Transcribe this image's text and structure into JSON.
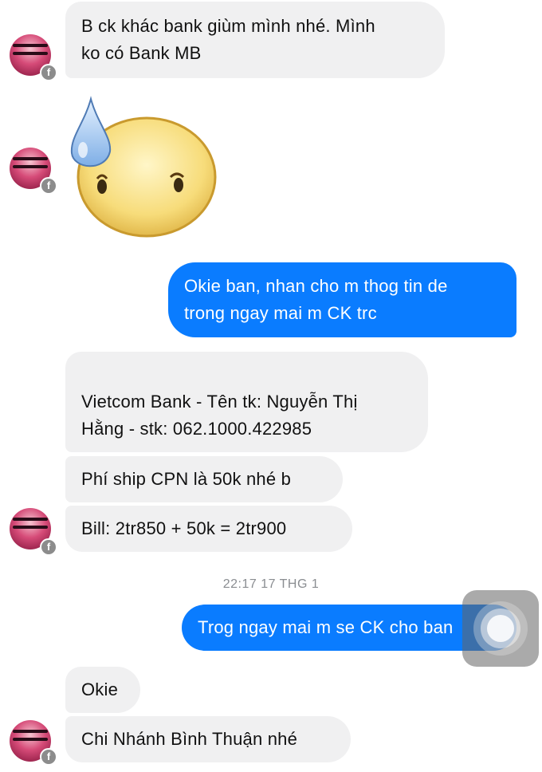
{
  "messages": [
    {
      "side": "in",
      "lines": [
        "B ck khác bank giùm mình nhé. Mình",
        "ko có Bank MB"
      ]
    },
    {
      "side": "in",
      "type": "sticker",
      "icon": "sweat-face-sticker-icon"
    },
    {
      "side": "out",
      "lines": [
        "Okie ban, nhan cho m thog tin de",
        "trong ngay mai m CK trc"
      ]
    },
    {
      "side": "in",
      "lines": [
        "",
        "Vietcom Bank - Tên tk: Nguyễn Thị",
        "Hằng - stk: 062.1000.422985"
      ]
    },
    {
      "side": "in",
      "lines": [
        "Phí ship CPN là 50k nhé b"
      ]
    },
    {
      "side": "in",
      "lines": [
        "Bill: 2tr850 + 50k = 2tr900"
      ]
    },
    {
      "side": "out",
      "lines": [
        "Trog ngay mai m se CK cho ban"
      ]
    },
    {
      "side": "in",
      "lines": [
        "Okie"
      ]
    },
    {
      "side": "in",
      "lines": [
        "Chi Nhánh Bình Thuận nhé"
      ]
    }
  ],
  "timestamp": "22:17 17 THG 1",
  "badge_glyph": "f",
  "colors": {
    "outgoing_bubble": "#0a7cff",
    "incoming_bubble": "#f0f0f1",
    "timestamp_text": "#8a8d91"
  }
}
